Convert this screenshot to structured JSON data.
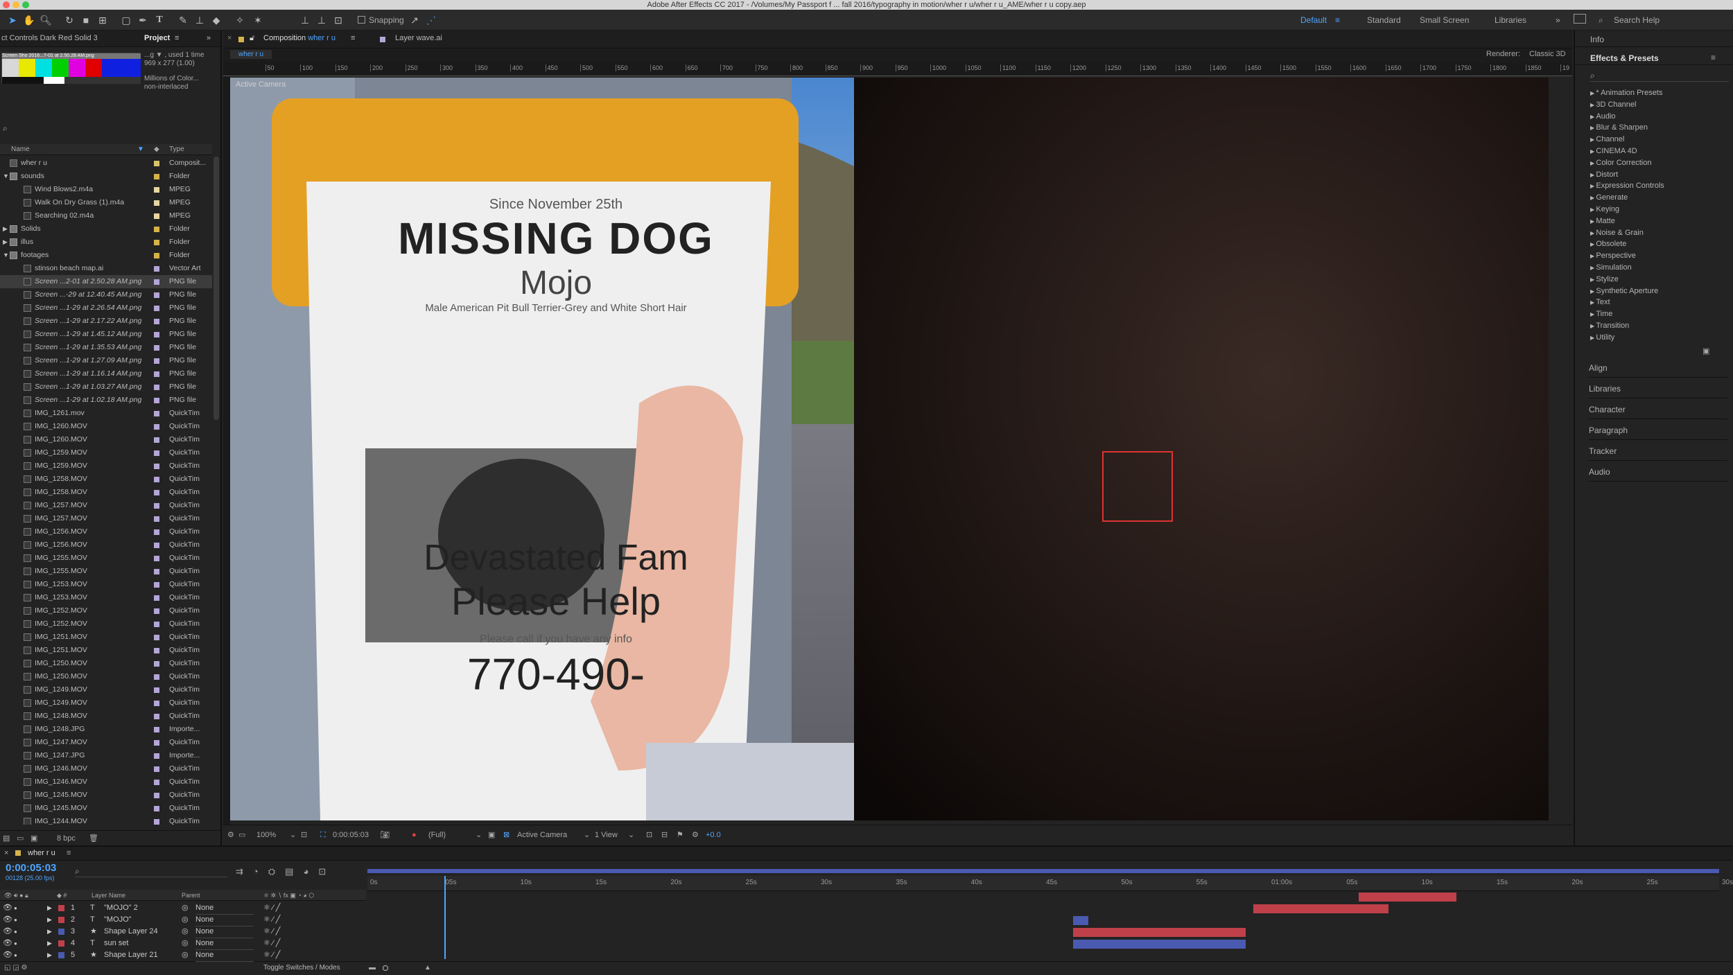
{
  "window": {
    "title": "Adobe After Effects CC 2017 - /Volumes/My Passport f ... fall 2016/typography in motion/wher r u/wher r u_AME/wher r u copy.aep"
  },
  "toolbar": {
    "snapping": "Snapping",
    "workspaces": [
      "Default",
      "Standard",
      "Small Screen",
      "Libraries"
    ],
    "search_placeholder": "Search Help"
  },
  "project": {
    "tab_effects": "ct Controls Dark Red Solid 3",
    "tab_project": "Project",
    "preview": {
      "name": "Screen Sho 2016...7-01 at 2.50.28 AM.png",
      "line1": "...g ▼ , used 1 time",
      "line2": "969 x 277 (1.00)",
      "line3": "Millions of Color...",
      "line4": "non-interlaced"
    },
    "col_name": "Name",
    "col_type": "Type",
    "items": [
      {
        "name": "wher r u",
        "type": "Composit...",
        "label": "#d9c36d",
        "indent": 0,
        "kind": "comp"
      },
      {
        "name": "sounds",
        "type": "Folder",
        "label": "#d6b34a",
        "indent": 0,
        "kind": "folder",
        "open": true
      },
      {
        "name": "Wind Blows2.m4a",
        "type": "MPEG",
        "label": "#e6d6a0",
        "indent": 1,
        "kind": "file"
      },
      {
        "name": "Walk On Dry Grass (1).m4a",
        "type": "MPEG",
        "label": "#e6d6a0",
        "indent": 1,
        "kind": "file"
      },
      {
        "name": "Searching 02.m4a",
        "type": "MPEG",
        "label": "#e6d6a0",
        "indent": 1,
        "kind": "file"
      },
      {
        "name": "Solids",
        "type": "Folder",
        "label": "#d6b34a",
        "indent": 0,
        "kind": "folder"
      },
      {
        "name": "illus",
        "type": "Folder",
        "label": "#d6b34a",
        "indent": 0,
        "kind": "folder"
      },
      {
        "name": "footages",
        "type": "Folder",
        "label": "#d6b34a",
        "indent": 0,
        "kind": "folder",
        "open": true
      },
      {
        "name": "stinson beach map.ai",
        "type": "Vector Art",
        "label": "#b4a6d6",
        "indent": 1,
        "kind": "file"
      },
      {
        "name": "Screen ...2-01 at 2.50.28 AM.png",
        "type": "PNG file",
        "label": "#b4a6d6",
        "indent": 1,
        "kind": "file",
        "sel": true
      },
      {
        "name": "Screen ...-29 at 12.40.45 AM.png",
        "type": "PNG file",
        "label": "#b4a6d6",
        "indent": 1,
        "kind": "file"
      },
      {
        "name": "Screen ...1-29 at 2.26.54 AM.png",
        "type": "PNG file",
        "label": "#b4a6d6",
        "indent": 1,
        "kind": "file"
      },
      {
        "name": "Screen ...1-29 at 2.17.22 AM.png",
        "type": "PNG file",
        "label": "#b4a6d6",
        "indent": 1,
        "kind": "file"
      },
      {
        "name": "Screen ...1-29 at 1.45.12 AM.png",
        "type": "PNG file",
        "label": "#b4a6d6",
        "indent": 1,
        "kind": "file"
      },
      {
        "name": "Screen ...1-29 at 1.35.53 AM.png",
        "type": "PNG file",
        "label": "#b4a6d6",
        "indent": 1,
        "kind": "file"
      },
      {
        "name": "Screen ...1-29 at 1.27.09 AM.png",
        "type": "PNG file",
        "label": "#b4a6d6",
        "indent": 1,
        "kind": "file"
      },
      {
        "name": "Screen ...1-29 at 1.16.14 AM.png",
        "type": "PNG file",
        "label": "#b4a6d6",
        "indent": 1,
        "kind": "file"
      },
      {
        "name": "Screen ...1-29 at 1.03.27 AM.png",
        "type": "PNG file",
        "label": "#b4a6d6",
        "indent": 1,
        "kind": "file"
      },
      {
        "name": "Screen ...1-29 at 1.02.18 AM.png",
        "type": "PNG file",
        "label": "#b4a6d6",
        "indent": 1,
        "kind": "file"
      },
      {
        "name": "IMG_1261.mov",
        "type": "QuickTim",
        "label": "#b4a6d6",
        "indent": 1,
        "kind": "file"
      },
      {
        "name": "IMG_1260.MOV",
        "type": "QuickTim",
        "label": "#b4a6d6",
        "indent": 1,
        "kind": "file"
      },
      {
        "name": "IMG_1260.MOV",
        "type": "QuickTim",
        "label": "#b4a6d6",
        "indent": 1,
        "kind": "file"
      },
      {
        "name": "IMG_1259.MOV",
        "type": "QuickTim",
        "label": "#b4a6d6",
        "indent": 1,
        "kind": "file"
      },
      {
        "name": "IMG_1259.MOV",
        "type": "QuickTim",
        "label": "#b4a6d6",
        "indent": 1,
        "kind": "file"
      },
      {
        "name": "IMG_1258.MOV",
        "type": "QuickTim",
        "label": "#b4a6d6",
        "indent": 1,
        "kind": "file"
      },
      {
        "name": "IMG_1258.MOV",
        "type": "QuickTim",
        "label": "#b4a6d6",
        "indent": 1,
        "kind": "file"
      },
      {
        "name": "IMG_1257.MOV",
        "type": "QuickTim",
        "label": "#b4a6d6",
        "indent": 1,
        "kind": "file"
      },
      {
        "name": "IMG_1257.MOV",
        "type": "QuickTim",
        "label": "#b4a6d6",
        "indent": 1,
        "kind": "file"
      },
      {
        "name": "IMG_1256.MOV",
        "type": "QuickTim",
        "label": "#b4a6d6",
        "indent": 1,
        "kind": "file"
      },
      {
        "name": "IMG_1256.MOV",
        "type": "QuickTim",
        "label": "#b4a6d6",
        "indent": 1,
        "kind": "file"
      },
      {
        "name": "IMG_1255.MOV",
        "type": "QuickTim",
        "label": "#b4a6d6",
        "indent": 1,
        "kind": "file"
      },
      {
        "name": "IMG_1255.MOV",
        "type": "QuickTim",
        "label": "#b4a6d6",
        "indent": 1,
        "kind": "file"
      },
      {
        "name": "IMG_1253.MOV",
        "type": "QuickTim",
        "label": "#b4a6d6",
        "indent": 1,
        "kind": "file"
      },
      {
        "name": "IMG_1253.MOV",
        "type": "QuickTim",
        "label": "#b4a6d6",
        "indent": 1,
        "kind": "file"
      },
      {
        "name": "IMG_1252.MOV",
        "type": "QuickTim",
        "label": "#b4a6d6",
        "indent": 1,
        "kind": "file"
      },
      {
        "name": "IMG_1252.MOV",
        "type": "QuickTim",
        "label": "#b4a6d6",
        "indent": 1,
        "kind": "file"
      },
      {
        "name": "IMG_1251.MOV",
        "type": "QuickTim",
        "label": "#b4a6d6",
        "indent": 1,
        "kind": "file"
      },
      {
        "name": "IMG_1251.MOV",
        "type": "QuickTim",
        "label": "#b4a6d6",
        "indent": 1,
        "kind": "file"
      },
      {
        "name": "IMG_1250.MOV",
        "type": "QuickTim",
        "label": "#b4a6d6",
        "indent": 1,
        "kind": "file"
      },
      {
        "name": "IMG_1250.MOV",
        "type": "QuickTim",
        "label": "#b4a6d6",
        "indent": 1,
        "kind": "file"
      },
      {
        "name": "IMG_1249.MOV",
        "type": "QuickTim",
        "label": "#b4a6d6",
        "indent": 1,
        "kind": "file"
      },
      {
        "name": "IMG_1249.MOV",
        "type": "QuickTim",
        "label": "#b4a6d6",
        "indent": 1,
        "kind": "file"
      },
      {
        "name": "IMG_1248.MOV",
        "type": "QuickTim",
        "label": "#b4a6d6",
        "indent": 1,
        "kind": "file"
      },
      {
        "name": "IMG_1248.JPG",
        "type": "Importe...",
        "label": "#b4a6d6",
        "indent": 1,
        "kind": "file"
      },
      {
        "name": "IMG_1247.MOV",
        "type": "QuickTim",
        "label": "#b4a6d6",
        "indent": 1,
        "kind": "file"
      },
      {
        "name": "IMG_1247.JPG",
        "type": "Importe...",
        "label": "#b4a6d6",
        "indent": 1,
        "kind": "file"
      },
      {
        "name": "IMG_1246.MOV",
        "type": "QuickTim",
        "label": "#b4a6d6",
        "indent": 1,
        "kind": "file"
      },
      {
        "name": "IMG_1246.MOV",
        "type": "QuickTim",
        "label": "#b4a6d6",
        "indent": 1,
        "kind": "file"
      },
      {
        "name": "IMG_1245.MOV",
        "type": "QuickTim",
        "label": "#b4a6d6",
        "indent": 1,
        "kind": "file"
      },
      {
        "name": "IMG_1245.MOV",
        "type": "QuickTim",
        "label": "#b4a6d6",
        "indent": 1,
        "kind": "file"
      },
      {
        "name": "IMG_1244.MOV",
        "type": "QuickTim",
        "label": "#b4a6d6",
        "indent": 1,
        "kind": "file"
      }
    ],
    "bpc": "8 bpc"
  },
  "viewer": {
    "tab_comp_prefix": "Composition",
    "tab_comp_name": "wher r u",
    "tab_layer": "Layer wave.ai",
    "breadcrumb": "wher r u",
    "renderer_label": "Renderer:",
    "renderer": "Classic 3D",
    "active_camera_overlay": "Active Camera",
    "ruler_ticks": [
      "50",
      "100",
      "150",
      "200",
      "250",
      "300",
      "350",
      "400",
      "450",
      "500",
      "550",
      "600",
      "650",
      "700",
      "750",
      "800",
      "850",
      "900",
      "950",
      "1000",
      "1050",
      "1100",
      "1150",
      "1200",
      "1250",
      "1300",
      "1350",
      "1400",
      "1450",
      "1500",
      "1550",
      "1600",
      "1650",
      "1700",
      "1750",
      "1800",
      "1850",
      "19"
    ],
    "zoom": "100%",
    "timecode": "0:00:05:03",
    "resolution": "(Full)",
    "camera": "Active Camera",
    "views": "1 View",
    "exposure": "+0.0",
    "poster": {
      "since": "Since November 25th",
      "title": "MISSING DOG",
      "name": "Mojo",
      "breed": "Male American Pit Bull Terrier-Grey and White Short Hair",
      "line1": "Devastated Fam",
      "line2": "Please Help",
      "call": "Please call if you have any info",
      "phone": "770-490-"
    }
  },
  "right_panel": {
    "info": "Info",
    "effects_title": "Effects & Presets",
    "categories": [
      "* Animation Presets",
      "3D Channel",
      "Audio",
      "Blur & Sharpen",
      "Channel",
      "CINEMA 4D",
      "Color Correction",
      "Distort",
      "Expression Controls",
      "Generate",
      "Keying",
      "Matte",
      "Noise & Grain",
      "Obsolete",
      "Perspective",
      "Simulation",
      "Stylize",
      "Synthetic Aperture",
      "Text",
      "Time",
      "Transition",
      "Utility"
    ],
    "panels": [
      "Align",
      "Libraries",
      "Character",
      "Paragraph",
      "Tracker",
      "Audio"
    ]
  },
  "timeline": {
    "tab": "wher r u",
    "timecode": "0:00:05:03",
    "frame_info": "00128 (25.00 fps)",
    "col_layer": "Layer Name",
    "col_parent": "Parent",
    "ruler": [
      "0s",
      "05s",
      "10s",
      "15s",
      "20s",
      "25s",
      "30s",
      "35s",
      "40s",
      "45s",
      "50s",
      "55s",
      "01:00s",
      "05s",
      "10s",
      "15s",
      "20s",
      "25s",
      "30s"
    ],
    "layers": [
      {
        "num": "1",
        "kind": "T",
        "name": "\"MOJO\" 2",
        "parent": "None",
        "color": "#c0404a"
      },
      {
        "num": "2",
        "kind": "T",
        "name": "\"MOJO\"",
        "parent": "None",
        "color": "#c0404a"
      },
      {
        "num": "3",
        "kind": "★",
        "name": "Shape Layer 24",
        "parent": "None",
        "color": "#4a5ab0"
      },
      {
        "num": "4",
        "kind": "T",
        "name": "sun set",
        "parent": "None",
        "color": "#c0404a"
      },
      {
        "num": "5",
        "kind": "★",
        "name": "Shape Layer 21",
        "parent": "None",
        "color": "#4a5ab0"
      }
    ],
    "bars_seconds": [
      [
        66,
        72.5
      ],
      [
        59,
        68
      ],
      [
        47,
        48
      ],
      [
        47,
        58.5
      ],
      [
        47,
        58.5
      ]
    ],
    "ruler_max_seconds": 90,
    "playhead_seconds": 5.1,
    "toggle": "Toggle Switches / Modes"
  }
}
